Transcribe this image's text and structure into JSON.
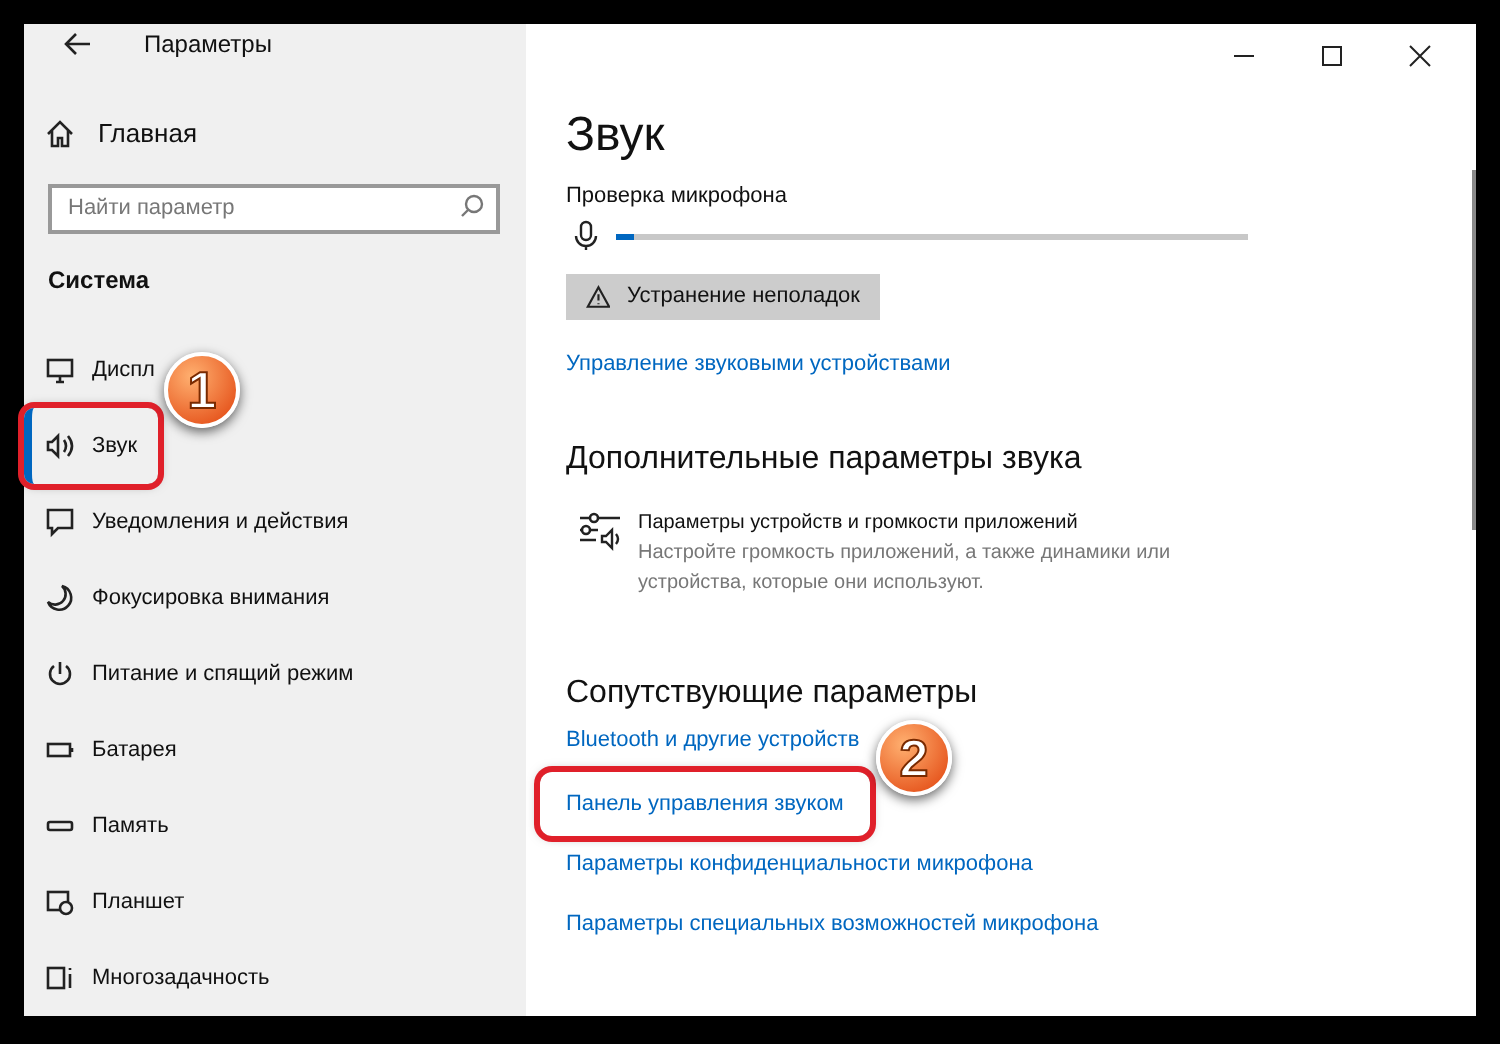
{
  "window": {
    "title": "Параметры"
  },
  "sidebar": {
    "home": "Главная",
    "search": {
      "placeholder": "Найти параметр"
    },
    "section": "Система",
    "items": [
      {
        "label": "Диспл",
        "selected": false,
        "highlighted": false
      },
      {
        "label": "Звук",
        "selected": true,
        "highlighted": true,
        "badge": "1"
      },
      {
        "label": "Уведомления и действия",
        "selected": false,
        "highlighted": false
      },
      {
        "label": "Фокусировка внимания",
        "selected": false,
        "highlighted": false
      },
      {
        "label": "Питание и спящий режим",
        "selected": false,
        "highlighted": false
      },
      {
        "label": "Батарея",
        "selected": false,
        "highlighted": false
      },
      {
        "label": "Память",
        "selected": false,
        "highlighted": false
      },
      {
        "label": "Планшет",
        "selected": false,
        "highlighted": false
      },
      {
        "label": "Многозадачность",
        "selected": false,
        "highlighted": false
      }
    ]
  },
  "content": {
    "title": "Звук",
    "mic_test": {
      "label": "Проверка микрофона",
      "level": 0.03
    },
    "troubleshoot_button": "Устранение неполадок",
    "manage_link": "Управление звуковыми устройствами",
    "advanced": {
      "heading": "Дополнительные параметры звука",
      "entry_title": "Параметры устройств и громкости приложений",
      "entry_description": "Настройте громкость приложений, а также динамики или устройства, которые они используют."
    },
    "related": {
      "heading": "Сопутствующие параметры",
      "links": [
        {
          "label": "Bluetooth и другие устройств",
          "highlighted": false
        },
        {
          "label": "Панель управления звуком",
          "highlighted": true,
          "badge": "2"
        },
        {
          "label": "Параметры конфиденциальности микрофона",
          "highlighted": false
        },
        {
          "label": "Параметры специальных возможностей микрофона",
          "highlighted": false
        }
      ]
    }
  }
}
